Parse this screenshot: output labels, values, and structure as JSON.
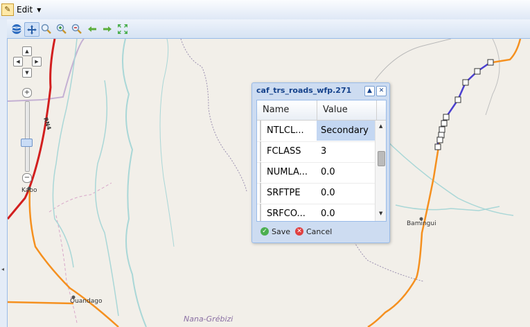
{
  "menubar": {
    "edit_label": "Edit"
  },
  "toolbar": {
    "tools": [
      "globe-icon",
      "pan-icon",
      "zoom-box-icon",
      "zoom-in-icon",
      "zoom-out-icon",
      "previous-extent-icon",
      "next-extent-icon",
      "full-extent-icon"
    ],
    "active_tool": "pan-icon"
  },
  "map": {
    "labels": {
      "kabo": "Kabo",
      "road": "RN4",
      "ouandago": "Ouandago",
      "bamingui": "Bamingui",
      "region": "Nana-Grébizi"
    },
    "colors": {
      "primary_road": "#d21f1f",
      "secondary_road": "#f5901f",
      "selected_road": "#4b3fd0",
      "river": "#a9d7d7",
      "boundary": "#b49bc4"
    }
  },
  "popup": {
    "title": "caf_trs_roads_wfp.271",
    "columns": {
      "name": "Name",
      "value": "Value"
    },
    "rows": [
      {
        "name": "NTLCL...",
        "value": "Secondary"
      },
      {
        "name": "FCLASS",
        "value": "3"
      },
      {
        "name": "NUMLA...",
        "value": "0.0"
      },
      {
        "name": "SRFTPE",
        "value": "0.0"
      },
      {
        "name": "SRFCO...",
        "value": "0.0"
      }
    ],
    "save_label": "Save",
    "cancel_label": "Cancel"
  }
}
